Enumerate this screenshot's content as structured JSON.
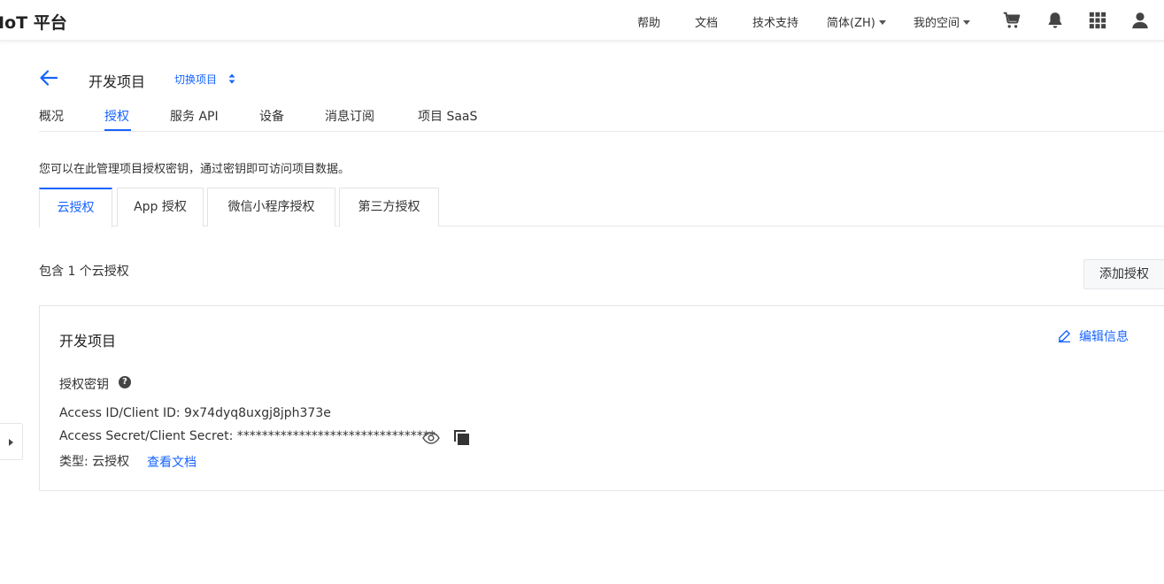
{
  "header": {
    "logo": "IoT 平台",
    "nav": {
      "help": "帮助",
      "docs": "文档",
      "support": "技术支持",
      "language": "简体(ZH)",
      "my_space": "我的空间"
    },
    "icons": [
      "cart-icon",
      "bell-icon",
      "apps-grid-icon",
      "user-icon"
    ]
  },
  "project": {
    "title": "开发项目",
    "switch_label": "切换项目"
  },
  "main_tabs": [
    {
      "label": "概况"
    },
    {
      "label": "授权"
    },
    {
      "label": "服务 API"
    },
    {
      "label": "设备"
    },
    {
      "label": "消息订阅"
    },
    {
      "label": "项目 SaaS"
    }
  ],
  "main_tabs_active": "授权",
  "intro_text": "您可以在此管理项目授权密钥，通过密钥即可访问项目数据。",
  "sub_tabs": [
    {
      "label": "云授权"
    },
    {
      "label": "App 授权"
    },
    {
      "label": "微信小程序授权"
    },
    {
      "label": "第三方授权"
    }
  ],
  "sub_tabs_active": "云授权",
  "auth_list": {
    "count_text": "包含 1 个云授权",
    "add_button": "添加授权"
  },
  "auth_card": {
    "title": "开发项目",
    "edit_label": "编辑信息",
    "key_label": "授权密钥",
    "help_glyph": "?",
    "access_id_line": "Access ID/Client ID: 9x74dyq8uxgj8jph373e",
    "access_secret_line": "Access Secret/Client Secret: ********************************",
    "type_line": "类型: 云授权",
    "doc_link": "查看文档"
  },
  "colors": {
    "accent": "#1664ff",
    "text": "#333333",
    "border": "#e3e5e8"
  }
}
